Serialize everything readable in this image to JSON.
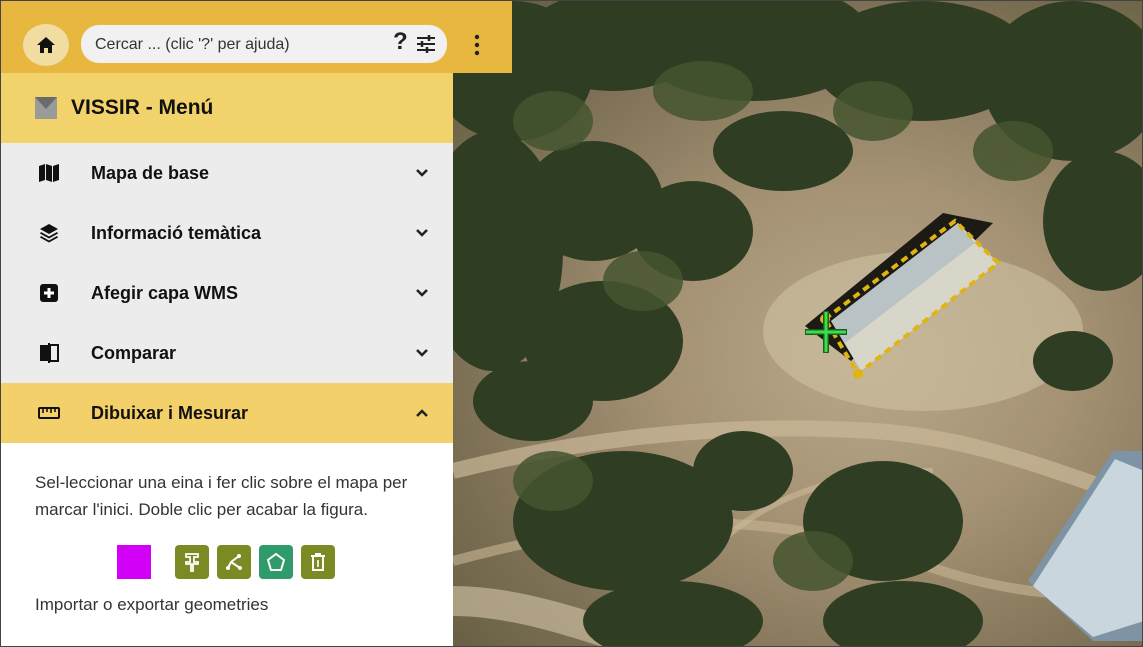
{
  "search": {
    "placeholder": "Cercar ... (clic '?' per ajuda)",
    "help_label": "?"
  },
  "menu": {
    "title": "VISSIR - Menú",
    "items": [
      {
        "label": "Mapa de base",
        "icon": "map-icon",
        "state": "collapsed"
      },
      {
        "label": "Informació temàtica",
        "icon": "layers-icon",
        "state": "collapsed"
      },
      {
        "label": "Afegir capa WMS",
        "icon": "add-layer-icon",
        "state": "collapsed"
      },
      {
        "label": "Comparar",
        "icon": "compare-icon",
        "state": "collapsed"
      },
      {
        "label": "Dibuixar i Mesurar",
        "icon": "ruler-icon",
        "state": "expanded"
      }
    ]
  },
  "draw": {
    "description": "Sel-leccionar una eina i fer clic sobre el mapa per marcar l'inici. Doble clic per acabar la figura.",
    "color": "#d200f7",
    "tools": [
      "point-tool-icon",
      "line-tool-icon",
      "polygon-tool-icon",
      "delete-tool-icon"
    ],
    "import_label": "Importar o exportar geometries"
  },
  "colors": {
    "topbar": "#e7b73f",
    "menu_header": "#f2d26a",
    "active_row": "#f3d06a",
    "tool": "#7b8a22",
    "tool_active": "#2f9b6a"
  }
}
